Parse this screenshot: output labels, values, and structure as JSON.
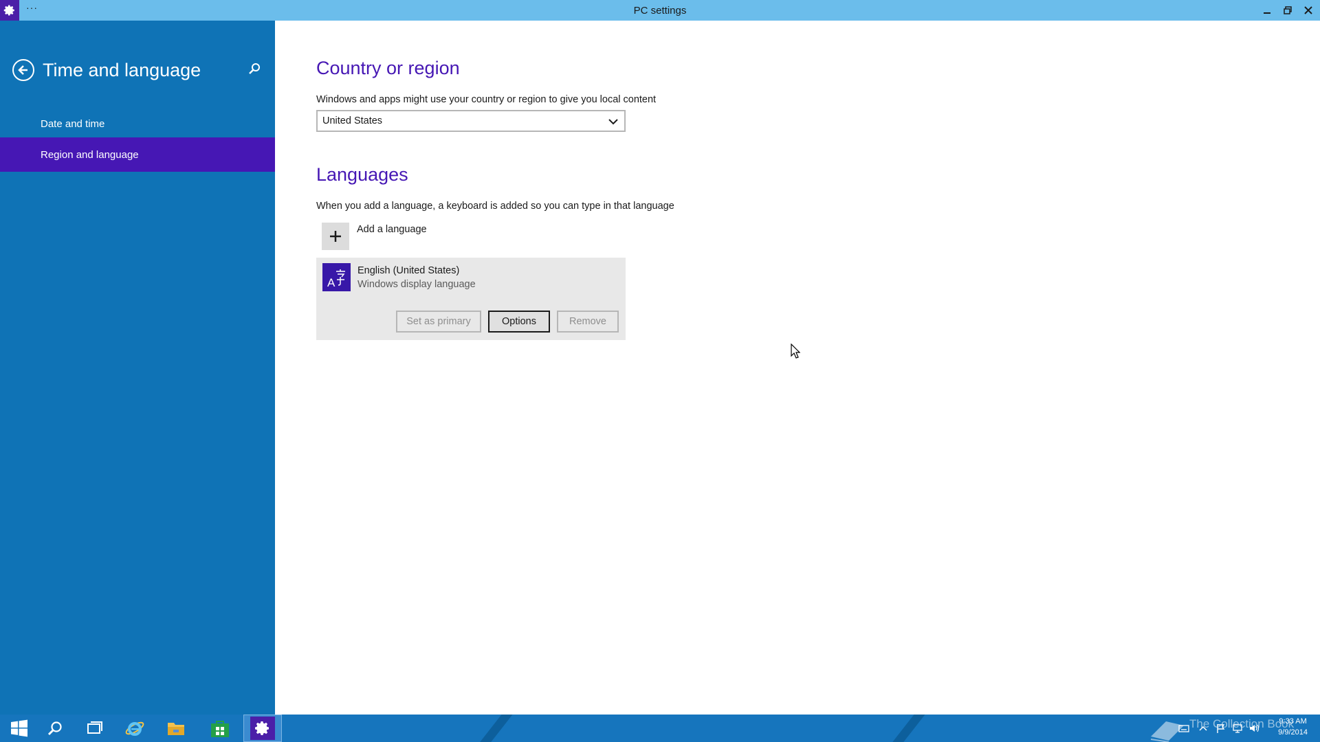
{
  "window": {
    "title": "PC settings",
    "menu_glyph": "···"
  },
  "sidebar": {
    "title": "Time and language",
    "items": [
      {
        "label": "Date and time",
        "active": false
      },
      {
        "label": "Region and language",
        "active": true
      }
    ]
  },
  "country": {
    "heading": "Country or region",
    "description": "Windows and apps might use your country or region to give you local content",
    "selected": "United States"
  },
  "languages": {
    "heading": "Languages",
    "description": "When you add a language, a keyboard is added so you can type in that language",
    "add_label": "Add a language",
    "items": [
      {
        "name": "English (United States)",
        "subtitle": "Windows display language",
        "buttons": {
          "set_primary": "Set as primary",
          "options": "Options",
          "remove": "Remove"
        }
      }
    ]
  },
  "taskbar": {
    "watermark": "The Collection Book",
    "time": "9:33 AM",
    "date": "9/9/2014"
  },
  "colors": {
    "titlebar": "#6bbdeb",
    "sidebar": "#0f73b6",
    "accent": "#4617b4",
    "taskbar": "#1675bd"
  }
}
